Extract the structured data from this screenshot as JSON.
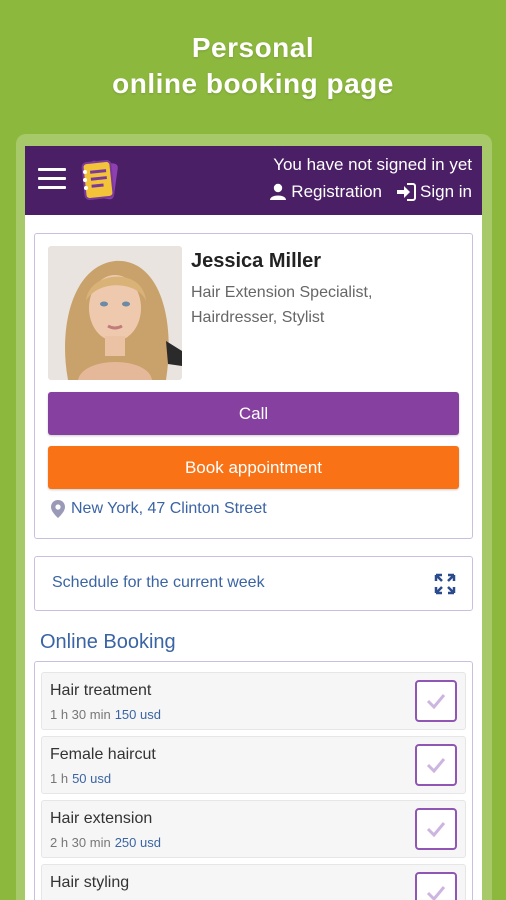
{
  "promo": {
    "line1": "Personal",
    "line2": "online booking page"
  },
  "header": {
    "signed_status": "You have not signed in yet",
    "registration_label": "Registration",
    "signin_label": "Sign in"
  },
  "profile": {
    "name": "Jessica Miller",
    "specialization_line1": "Hair Extension Specialist,",
    "specialization_line2": "Hairdresser, Stylist",
    "call_label": "Call",
    "book_label": "Book appointment",
    "address": "New York, 47 Clinton Street"
  },
  "schedule": {
    "label": "Schedule for the current week"
  },
  "booking": {
    "title": "Online Booking",
    "services": [
      {
        "name": "Hair treatment",
        "duration": "1 h 30 min",
        "price": "150 usd"
      },
      {
        "name": "Female haircut",
        "duration": "1 h",
        "price": "50 usd"
      },
      {
        "name": "Hair extension",
        "duration": "2 h 30 min",
        "price": "250 usd"
      },
      {
        "name": "Hair styling",
        "duration": "",
        "price": ""
      }
    ]
  },
  "colors": {
    "background": "#8db83e",
    "appbar": "#4a1f66",
    "call_button": "#86409f",
    "book_button": "#f97316",
    "link": "#3b64a4"
  },
  "icons": [
    "menu-icon",
    "app-logo-icon",
    "user-icon",
    "sign-in-icon",
    "location-pin-icon",
    "expand-icon",
    "checkmark-icon"
  ]
}
